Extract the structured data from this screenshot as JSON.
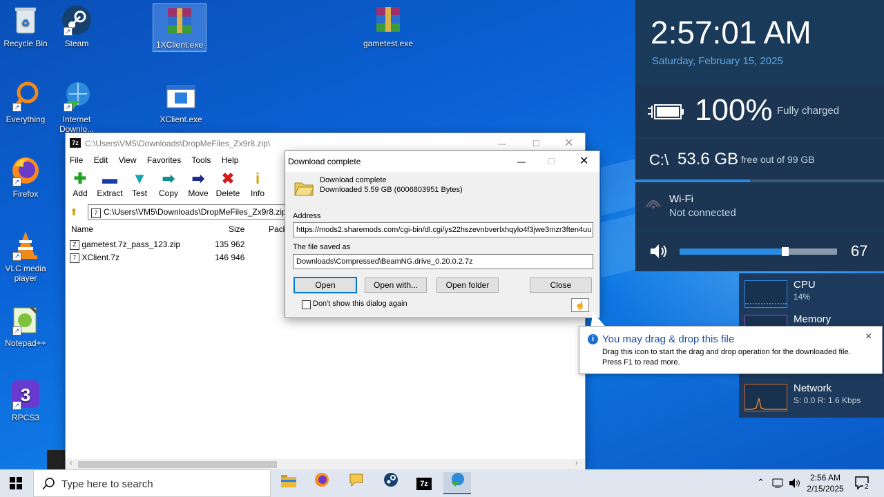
{
  "desktop": {
    "icons": [
      {
        "label": "Recycle Bin"
      },
      {
        "label": "Steam"
      },
      {
        "label": "1XClient.exe"
      },
      {
        "label": "gametest.exe"
      },
      {
        "label": "Everything"
      },
      {
        "label": "Internet Downlo..."
      },
      {
        "label": "XClient.exe"
      },
      {
        "label": "Firefox"
      },
      {
        "label": "VLC media player"
      },
      {
        "label": "Notepad++"
      },
      {
        "label": "RPCS3"
      }
    ]
  },
  "side_panel": {
    "time": "2:57:01 AM",
    "date": "Saturday, February 15, 2025",
    "battery_percent": "100%",
    "battery_status": "Fully charged",
    "disk_label": "C:\\",
    "disk_free": "53.6 GB",
    "disk_total": "free out of 99 GB",
    "wifi_title": "Wi-Fi",
    "wifi_status": "Not connected",
    "volume_value": "67",
    "volume_level": 0.67
  },
  "perf_panel": {
    "cpu_label": "CPU",
    "cpu_value": "14%",
    "memory_label": "Memory",
    "network_label": "Network",
    "network_s": "S: 0.0",
    "network_r": "R: 1.6 Kbps"
  },
  "winrar": {
    "title": "C:\\Users\\VM5\\Downloads\\DropMeFiles_Zx9r8.zip\\",
    "menu": [
      "File",
      "Edit",
      "View",
      "Favorites",
      "Tools",
      "Help"
    ],
    "toolbar": [
      "Add",
      "Extract",
      "Test",
      "Copy",
      "Move",
      "Delete",
      "Info"
    ],
    "path": "C:\\Users\\VM5\\Downloads\\DropMeFiles_Zx9r8.zip\\",
    "columns": {
      "name": "Name",
      "size": "Size",
      "packed": "Pack"
    },
    "files": [
      {
        "name": "gametest.7z_pass_123.zip",
        "size": "135 962"
      },
      {
        "name": "XClient.7z",
        "size": "146 946"
      }
    ]
  },
  "dialog": {
    "title": "Download complete",
    "heading": "Download complete",
    "downloaded": "Downloaded 5.59  GB (6006803951 Bytes)",
    "address_label": "Address",
    "address": "https://mods2.sharemods.com/cgi-bin/dl.cgi/ys22hszevnbverlxhqylo4f3jwe3mzr3ften4uu",
    "saved_label": "The file saved as",
    "saved_path": "Downloads\\Compressed\\BeamNG.drive_0.20.0.2.7z",
    "buttons": {
      "open": "Open",
      "open_with": "Open with...",
      "open_folder": "Open folder",
      "close": "Close"
    },
    "checkbox": "Don't show this dialog again"
  },
  "tooltip": {
    "title": "You may drag & drop this file",
    "line1": "Drag this icon to start the drag and drop operation for the downloaded file.",
    "line2": "Press F1 to read more.",
    "close": "×"
  },
  "taskbar": {
    "search_placeholder": "Type here to search",
    "time": "2:56 AM",
    "date": "2/15/2025",
    "notifications": "2"
  }
}
